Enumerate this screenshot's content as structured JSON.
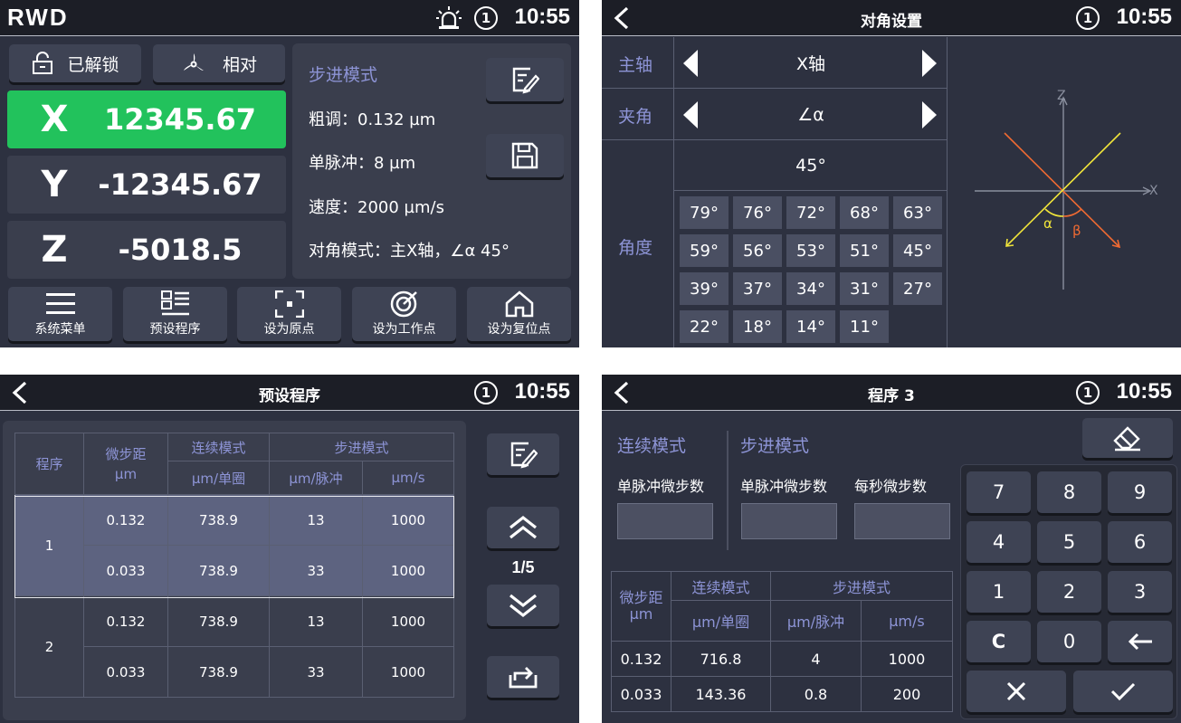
{
  "q1": {
    "logo": "RWD",
    "notification": "1",
    "time": "10:55",
    "lock_label": "已解锁",
    "relative_label": "相对",
    "axes": [
      {
        "label": "X",
        "value": "12345.67"
      },
      {
        "label": "Y",
        "value": "-12345.67"
      },
      {
        "label": "Z",
        "value": "-5018.5"
      }
    ],
    "info": {
      "title": "步进模式",
      "coarse": "粗调：0.132 µm",
      "pulse": "单脉冲：8 µm",
      "speed": "速度：2000 µm/s",
      "diagonal": "对角模式：主X轴，∠α 45°"
    },
    "bottom": [
      "系统菜单",
      "预设程序",
      "设为原点",
      "设为工作点",
      "设为复位点"
    ]
  },
  "q2": {
    "title": "对角设置",
    "notification": "1",
    "time": "10:55",
    "main_axis_label": "主轴",
    "main_axis_value": "X轴",
    "angle_label": "夹角",
    "angle_value": "∠α",
    "degree_label": "角度",
    "current_degree": "45°",
    "degrees": [
      "79°",
      "76°",
      "72°",
      "68°",
      "63°",
      "59°",
      "56°",
      "53°",
      "51°",
      "45°",
      "39°",
      "37°",
      "34°",
      "31°",
      "27°",
      "22°",
      "18°",
      "14°",
      "11°"
    ],
    "diagram": {
      "z": "Z",
      "x": "X",
      "alpha": "α",
      "beta": "β"
    }
  },
  "q3": {
    "title": "预设程序",
    "notification": "1",
    "time": "10:55",
    "headers": {
      "program": "程序",
      "microstep": "微步距",
      "unit": "µm",
      "continuous": "连续模式",
      "step": "步进模式",
      "per_turn": "µm/单圈",
      "per_pulse": "µm/脉冲",
      "per_sec": "µm/s"
    },
    "programs": [
      {
        "id": "1",
        "rows": [
          [
            "0.132",
            "738.9",
            "13",
            "1000"
          ],
          [
            "0.033",
            "738.9",
            "33",
            "1000"
          ]
        ]
      },
      {
        "id": "2",
        "rows": [
          [
            "0.132",
            "738.9",
            "13",
            "1000"
          ],
          [
            "0.033",
            "738.9",
            "33",
            "1000"
          ]
        ]
      }
    ],
    "page": "1/5"
  },
  "q4": {
    "title": "程序 3",
    "notification": "1",
    "time": "10:55",
    "continuous_title": "连续模式",
    "step_title": "步进模式",
    "pulse_micro": "单脉冲微步数",
    "pulse_micro2": "单脉冲微步数",
    "sec_micro": "每秒微步数",
    "headers": {
      "microstep": "微步距",
      "unit": "µm",
      "continuous": "连续模式",
      "step": "步进模式",
      "per_turn": "µm/单圈",
      "per_pulse": "µm/脉冲",
      "per_sec": "µm/s"
    },
    "rows": [
      [
        "0.132",
        "716.8",
        "4",
        "1000"
      ],
      [
        "0.033",
        "143.36",
        "0.8",
        "200"
      ]
    ],
    "keys": [
      "7",
      "8",
      "9",
      "4",
      "5",
      "6",
      "1",
      "2",
      "3",
      "C",
      "0"
    ]
  }
}
